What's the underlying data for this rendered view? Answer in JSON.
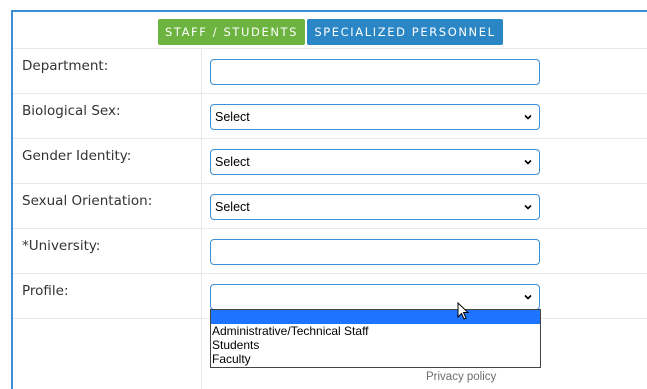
{
  "tabs": [
    {
      "label": "STAFF / STUDENTS",
      "color": "#6cb33f"
    },
    {
      "label": "SPECIALIZED PERSONNEL",
      "color": "#2b86c5"
    }
  ],
  "form": {
    "department": {
      "label": "Department:",
      "value": ""
    },
    "biological_sex": {
      "label": "Biological Sex:",
      "value": "Select"
    },
    "gender_identity": {
      "label": "Gender Identity:",
      "value": "Select"
    },
    "sexual_orientation": {
      "label": "Sexual Orientation:",
      "value": "Select"
    },
    "university": {
      "label": "*University:",
      "value": ""
    },
    "profile": {
      "label": "Profile:",
      "value": "",
      "options": [
        "",
        "Administrative/Technical Staff",
        "Students",
        "Faculty"
      ]
    }
  },
  "footer": {
    "privacy_label": "Privacy policy"
  },
  "icons": {
    "select_arrow": "chevron-down-icon",
    "pointer": "mouse-cursor-icon"
  },
  "colors": {
    "accent": "#3b8fd6",
    "highlight": "#1e74ff"
  }
}
